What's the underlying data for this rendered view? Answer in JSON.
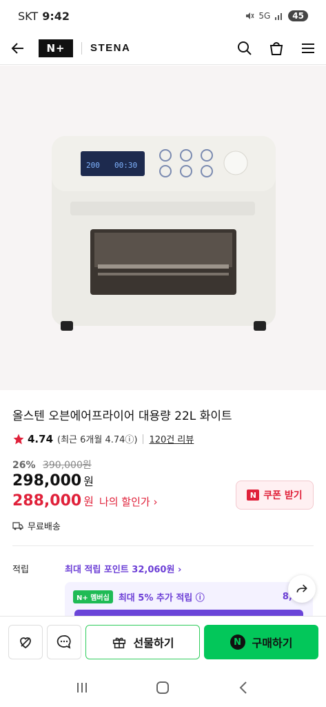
{
  "status": {
    "carrier": "SKT",
    "time": "9:42",
    "net": "5G",
    "battery": "45"
  },
  "nav": {
    "logo": "N+",
    "brand": "STENA"
  },
  "oven_display": {
    "left": "200",
    "right": "00:30"
  },
  "product": {
    "title": "올스텐 오븐에어프라이어 대용량 22L 화이트",
    "rating": "4.74",
    "recent": "(최근 6개월 4.74ⓘ)",
    "reviews": "120건 리뷰",
    "discount_pct": "26%",
    "original_price": "390,000원",
    "price": "298,000",
    "my_price": "288,000",
    "won": "원",
    "my_price_label": "나의 할인가 ›",
    "coupon": "쿠폰 받기",
    "shipping": "무료배송"
  },
  "points": {
    "label": "적립",
    "max": "최대 적립 포인트 32,060원 ›",
    "badge": "N+ 멤버십",
    "extra": "최대 5% 추가 적립 ⓘ",
    "amount": "8,88"
  },
  "actions": {
    "gift": "선물하기",
    "buy": "구매하기"
  },
  "colors": {
    "accent_red": "#e0213a",
    "naver_green": "#03c75a",
    "points_purple": "#6c3fd6"
  }
}
